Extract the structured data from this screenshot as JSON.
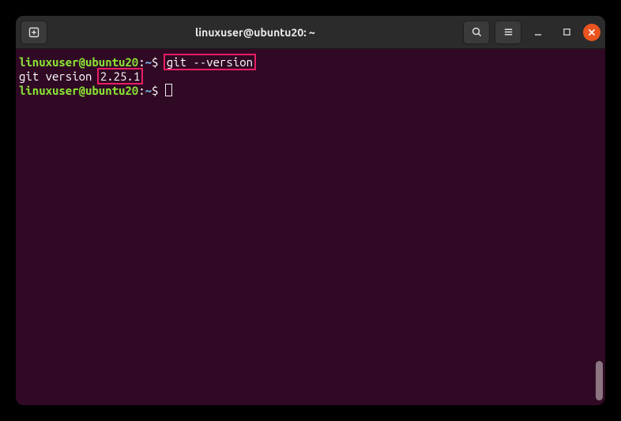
{
  "titlebar": {
    "title": "linuxuser@ubuntu20: ~"
  },
  "terminal": {
    "line1": {
      "user_host": "linuxuser@ubuntu20",
      "sep1": ":",
      "path": "~",
      "sep2": "$ ",
      "command": "git --version"
    },
    "line2": {
      "prefix": "git version ",
      "version": "2.25.1"
    },
    "line3": {
      "user_host": "linuxuser@ubuntu20",
      "sep1": ":",
      "path": "~",
      "sep2": "$ "
    }
  }
}
